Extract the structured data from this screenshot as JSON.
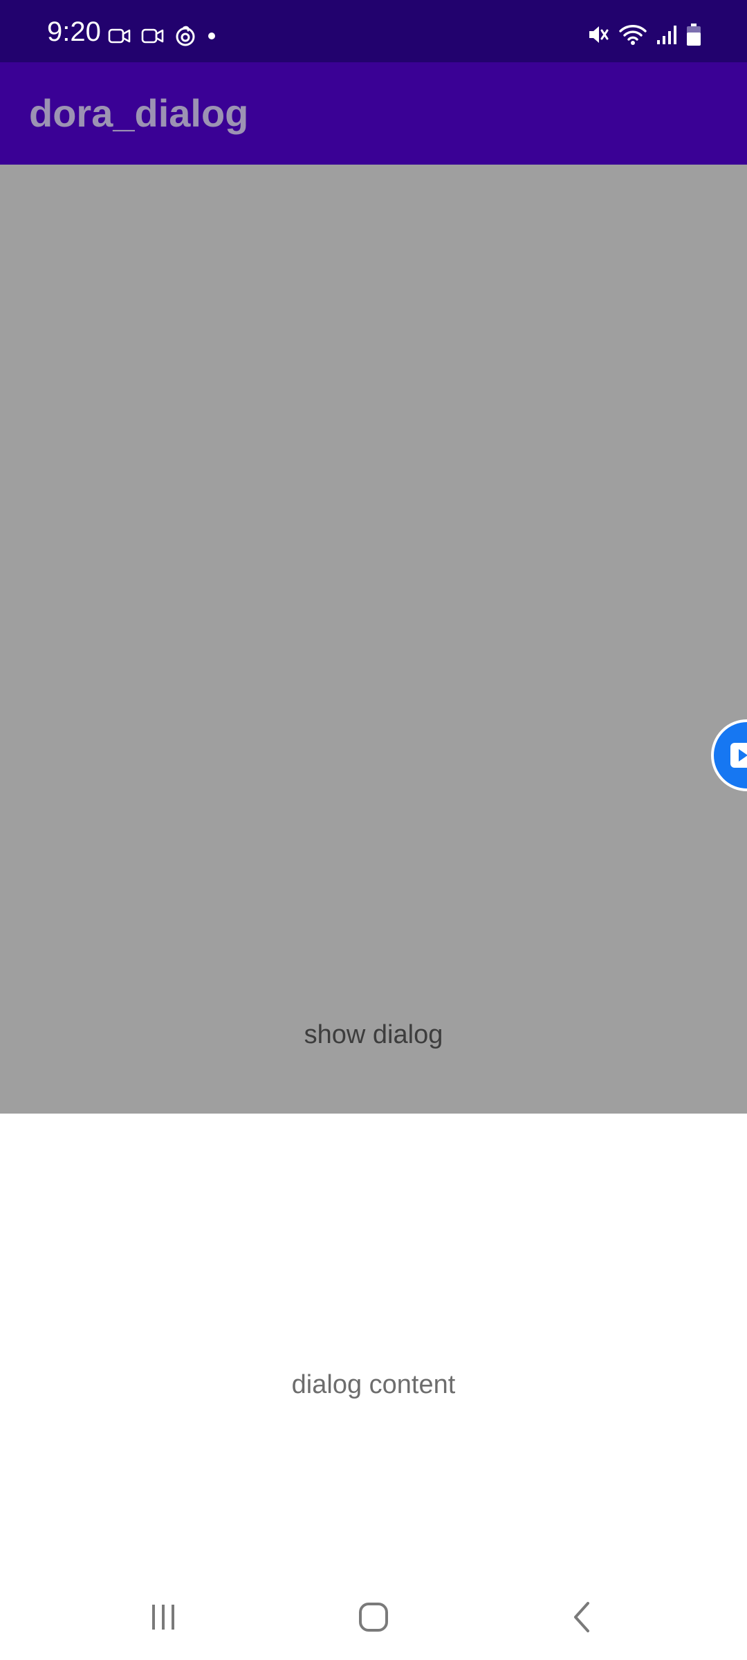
{
  "status_bar": {
    "time": "9:20",
    "left_icons": [
      "video-call-icon",
      "video-call-icon",
      "netease-music-icon",
      "notification-dot-icon"
    ],
    "right_icons": [
      "mute-icon",
      "wifi-icon",
      "signal-icon",
      "battery-icon"
    ]
  },
  "app_bar": {
    "title": "dora_dialog",
    "background": "#3a0195",
    "status_background": "#22026e"
  },
  "content": {
    "show_dialog_label": "show dialog",
    "scrim_color": "#9f9f9f"
  },
  "floating_bubble": {
    "icon": "play-icon",
    "color": "#1677f2"
  },
  "dialog": {
    "content_text": "dialog content"
  },
  "nav_bar": {
    "recents_icon": "recents-icon",
    "home_icon": "home-icon",
    "back_icon": "back-icon"
  }
}
